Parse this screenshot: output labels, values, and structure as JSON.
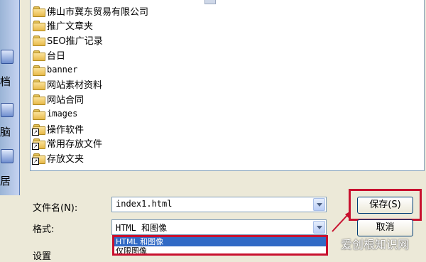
{
  "places": {
    "glyphs": [
      "档",
      "脑",
      "居"
    ]
  },
  "files": [
    {
      "name": "佛山市冀东贸易有限公司",
      "type": "folder"
    },
    {
      "name": "推广文章夹",
      "type": "folder"
    },
    {
      "name": "SEO推广记录",
      "type": "folder"
    },
    {
      "name": "台日",
      "type": "folder"
    },
    {
      "name": "banner",
      "type": "folder"
    },
    {
      "name": "网站素材资料",
      "type": "folder"
    },
    {
      "name": "网站合同",
      "type": "folder"
    },
    {
      "name": "images",
      "type": "folder"
    },
    {
      "name": "操作软件",
      "type": "shortcut-folder"
    },
    {
      "name": "常用存放文件",
      "type": "shortcut-folder"
    },
    {
      "name": "存放文夹",
      "type": "shortcut-folder"
    }
  ],
  "form": {
    "filename_label": "文件名(N):",
    "filename_value": "index1.html",
    "format_label": "格式:",
    "format_value": "HTML 和图像",
    "settings_label": "设置",
    "save_button": "保存(S)",
    "cancel_button": "取消",
    "format_options": [
      "HTML 和图像",
      "仅限图像"
    ]
  },
  "watermark": "爱创根知识网",
  "colors": {
    "highlight": "#c8102e",
    "selection": "#316ac5"
  }
}
